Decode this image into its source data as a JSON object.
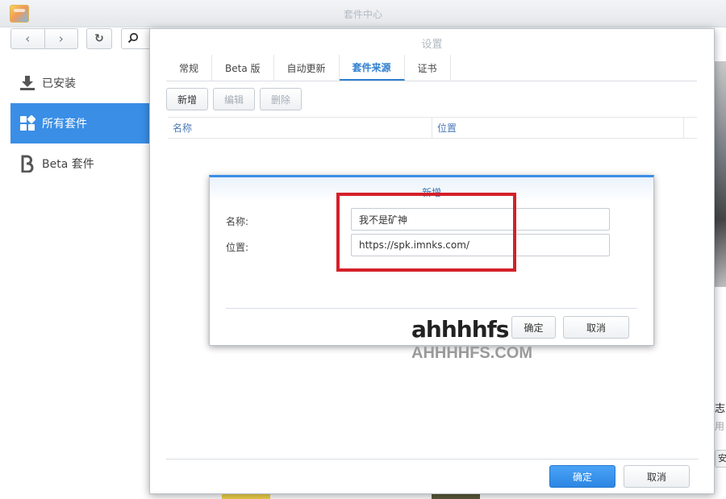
{
  "window": {
    "title": "套件中心"
  },
  "sidebar": {
    "items": [
      {
        "label": "已安装",
        "icon": "download-icon"
      },
      {
        "label": "所有套件",
        "icon": "grid-icon"
      },
      {
        "label": "Beta 套件",
        "icon": "beta-icon"
      }
    ]
  },
  "settings": {
    "title": "设置",
    "tabs": [
      "常规",
      "Beta 版",
      "自动更新",
      "套件来源",
      "证书"
    ],
    "active_tab": "套件来源",
    "buttons": {
      "add": "新增",
      "edit": "编辑",
      "delete": "删除"
    },
    "columns": [
      "名称",
      "位置"
    ],
    "ok": "确定",
    "cancel": "取消"
  },
  "add_dialog": {
    "title": "新增",
    "name_label": "名称:",
    "location_label": "位置:",
    "name_value": "我不是矿神",
    "location_value": "https://spk.imnks.com/",
    "ok": "确定",
    "cancel": "取消"
  },
  "right_strip": {
    "text1": "志",
    "text2": "用",
    "button": "安"
  },
  "watermark": {
    "logo": "ahhhhfs",
    "sub": "AHHHHFS.COM"
  },
  "colors": {
    "accent": "#3a8ee6",
    "highlight_box": "#d4202a"
  }
}
